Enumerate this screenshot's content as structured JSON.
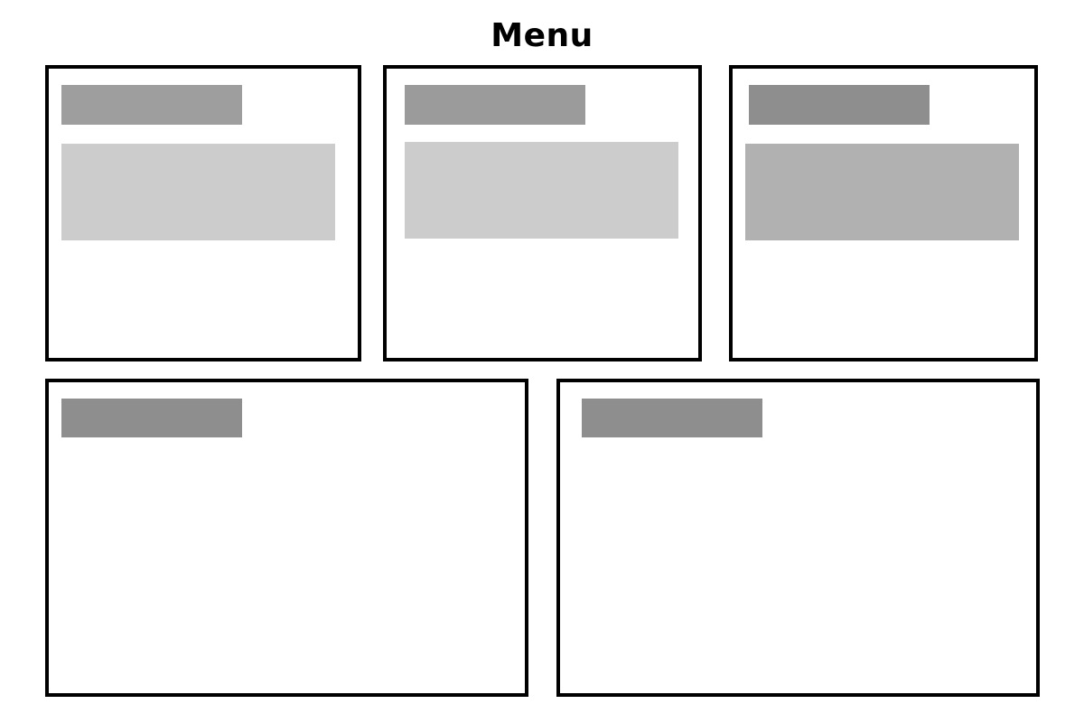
{
  "page": {
    "title": "Menu"
  },
  "colors": {
    "background": "#ffffff",
    "border": "#000000",
    "header_bar_light": "#9b9b9b",
    "header_bar_dark": "#8e8e8e",
    "content_block_light": "#cccccc",
    "content_block_mid": "#b1b1b1"
  },
  "panels": [
    {
      "header_color": "#9e9e9e",
      "content_color": "#cccccc",
      "has_content_block": true
    },
    {
      "header_color": "#9b9b9b",
      "content_color": "#cccccc",
      "has_content_block": true
    },
    {
      "header_color": "#8e8e8e",
      "content_color": "#b1b1b1",
      "has_content_block": true
    },
    {
      "header_color": "#8e8e8e",
      "has_content_block": false
    },
    {
      "header_color": "#8e8e8e",
      "has_content_block": false
    }
  ]
}
